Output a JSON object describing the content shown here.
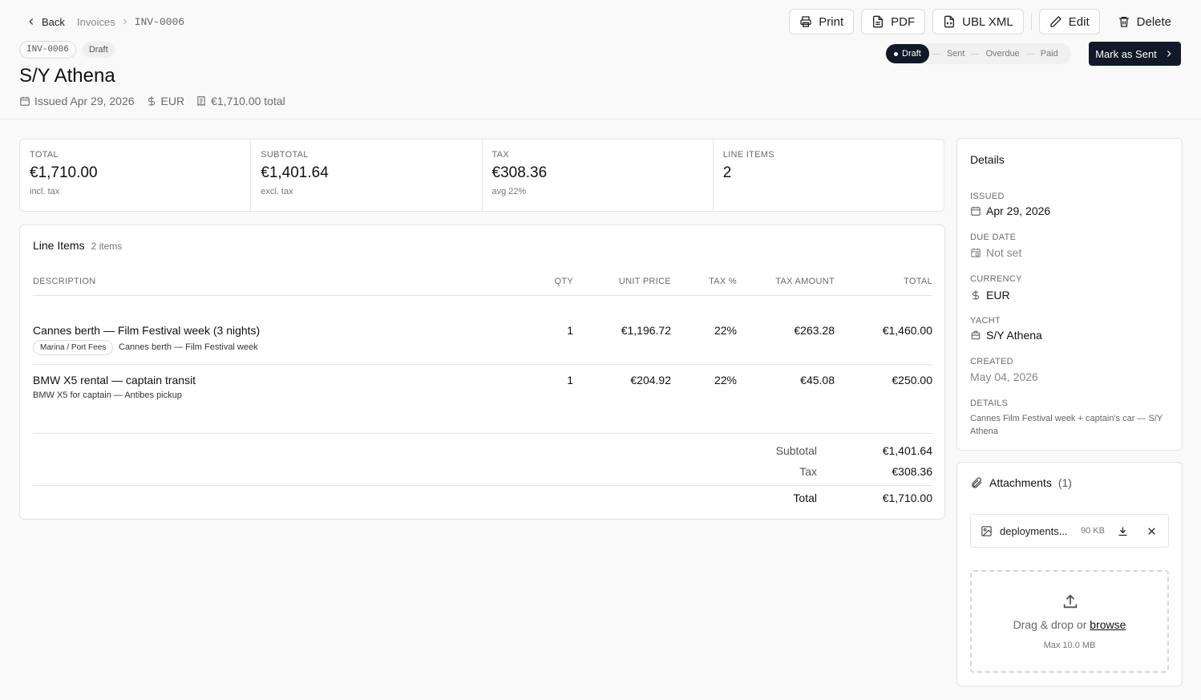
{
  "header": {
    "back_label": "Back",
    "breadcrumb": {
      "parent": "Invoices",
      "current": "INV-0006"
    },
    "invoice_id_badge": "INV-0006",
    "status_badge": "Draft",
    "title": "S/Y Athena",
    "meta": {
      "issued": "Issued Apr 29, 2026",
      "currency": "EUR",
      "total": "€1,710.00 total"
    }
  },
  "toolbar": {
    "print": "Print",
    "pdf": "PDF",
    "ubl": "UBL XML",
    "edit": "Edit",
    "delete": "Delete"
  },
  "workflow": {
    "steps": [
      "Draft",
      "Sent",
      "Overdue",
      "Paid"
    ],
    "active": "Draft",
    "action_label": "Mark as Sent"
  },
  "stats": [
    {
      "label": "TOTAL",
      "value": "€1,710.00",
      "sub": "incl. tax"
    },
    {
      "label": "SUBTOTAL",
      "value": "€1,401.64",
      "sub": "excl. tax"
    },
    {
      "label": "TAX",
      "value": "€308.36",
      "sub": "avg 22%"
    },
    {
      "label": "LINE ITEMS",
      "value": "2",
      "sub": ""
    }
  ],
  "line_items": {
    "title": "Line Items",
    "count": "2 items",
    "columns": [
      "DESCRIPTION",
      "QTY",
      "UNIT PRICE",
      "TAX %",
      "TAX AMOUNT",
      "TOTAL"
    ],
    "rows": [
      {
        "description": "Cannes berth — Film Festival week (3 nights)",
        "category": "Marina / Port Fees",
        "note": "Cannes berth — Film Festival week",
        "qty": "1",
        "unit_price": "€1,196.72",
        "tax_pct": "22%",
        "tax_amount": "€263.28",
        "total": "€1,460.00"
      },
      {
        "description": "BMW X5 rental — captain transit",
        "category": "",
        "note": "BMW X5 for captain — Antibes pickup",
        "qty": "1",
        "unit_price": "€204.92",
        "tax_pct": "22%",
        "tax_amount": "€45.08",
        "total": "€250.00"
      }
    ],
    "summary": {
      "subtotal_label": "Subtotal",
      "subtotal": "€1,401.64",
      "tax_label": "Tax",
      "tax": "€308.36",
      "total_label": "Total",
      "total": "€1,710.00"
    }
  },
  "details": {
    "title": "Details",
    "issued_label": "ISSUED",
    "issued": "Apr 29, 2026",
    "due_label": "DUE DATE",
    "due": "Not set",
    "currency_label": "CURRENCY",
    "currency": "EUR",
    "yacht_label": "YACHT",
    "yacht": "S/Y Athena",
    "created_label": "CREATED",
    "created": "May 04, 2026",
    "details_label": "DETAILS",
    "details_text": "Cannes Film Festival week + captain's car — S/Y Athena"
  },
  "attachments": {
    "title": "Attachments",
    "count": "(1)",
    "files": [
      {
        "name": "deployments...",
        "size": "90 KB"
      }
    ],
    "drop_text": "Drag & drop or ",
    "drop_link": "browse",
    "max_size": "Max 10.0 MB"
  }
}
